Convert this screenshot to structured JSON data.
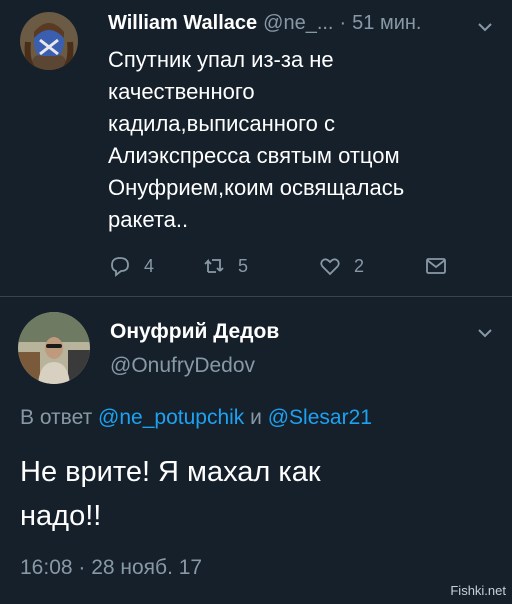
{
  "tweet1": {
    "author_name": "William Wallace",
    "handle": "@ne_...",
    "separator": "·",
    "time": "51 мин.",
    "lines": [
      "Спутник упал из-за не",
      "качественного",
      "кадила,выписанного с",
      "Алиэкспресса святым отцом",
      "Онуфрием,коим освящалась",
      "ракета.."
    ],
    "reply_count": "4",
    "retweet_count": "5",
    "like_count": "2"
  },
  "tweet2": {
    "author_name": "Онуфрий Дедов",
    "handle": "@OnufryDedov",
    "replying_prefix": "В ответ",
    "mention1": "@ne_potupchik",
    "replying_and": "и",
    "mention2": "@Slesar21",
    "lines": [
      "Не врите! Я махал как",
      "надо!!"
    ],
    "timestamp": "16:08 · 28 нояб. 17"
  },
  "watermark": "Fishki.net",
  "colors": {
    "background": "#15202b",
    "secondary_text": "#8899a6",
    "link": "#1da1f2",
    "divider": "#38444d"
  },
  "icons": [
    "reply-icon",
    "retweet-icon",
    "like-icon",
    "message-icon",
    "chevron-down-icon"
  ]
}
